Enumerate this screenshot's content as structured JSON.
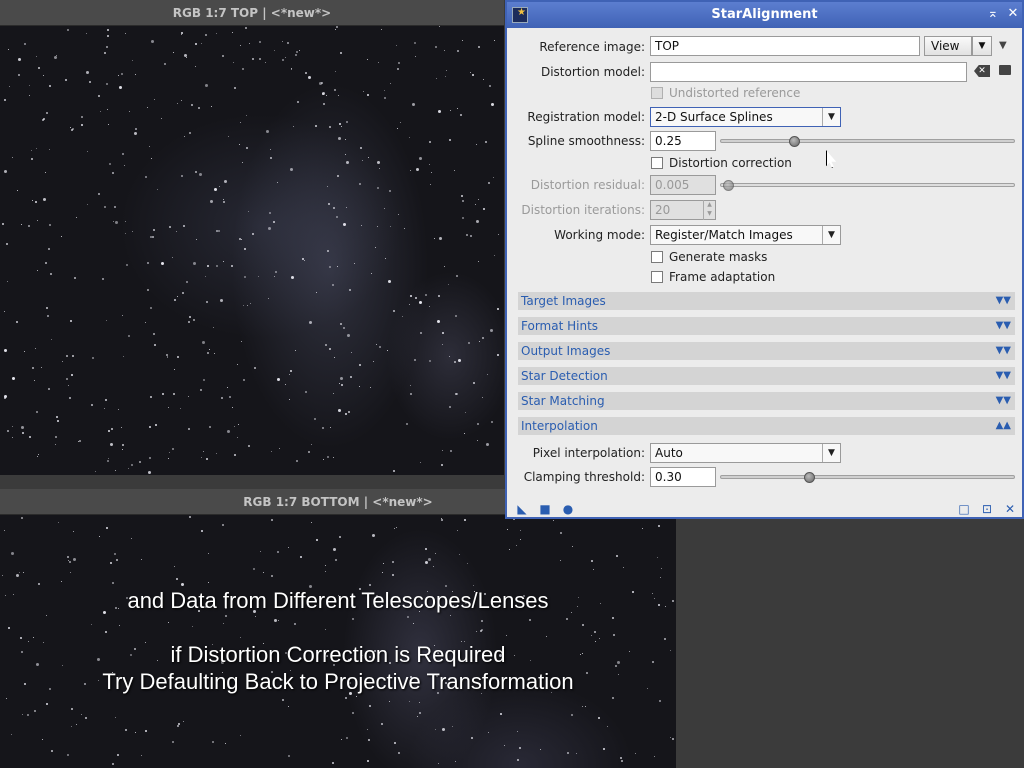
{
  "top_window": {
    "title": "RGB 1:7 TOP | <*new*>"
  },
  "bottom_window": {
    "title": "RGB 1:7 BOTTOM | <*new*>"
  },
  "captions": [
    "and Data from Different Telescopes/Lenses",
    "if Distortion Correction is Required",
    "Try Defaulting Back to Projective Transformation"
  ],
  "dialog": {
    "title": "StarAlignment",
    "title_buttons": {
      "shade": "⌅",
      "close": "✕"
    },
    "reference_image": {
      "label": "Reference image:",
      "value": "TOP",
      "view_label": "View"
    },
    "distortion_model": {
      "label": "Distortion model:",
      "value": ""
    },
    "undistorted_reference": {
      "label": "Undistorted reference",
      "checked": false,
      "enabled": false
    },
    "registration_model": {
      "label": "Registration model:",
      "value": "2-D Surface Splines"
    },
    "spline_smoothness": {
      "label": "Spline smoothness:",
      "value": "0.25",
      "level": 0.25
    },
    "distortion_correction": {
      "label": "Distortion correction",
      "checked": false
    },
    "distortion_residual": {
      "label": "Distortion residual:",
      "value": "0.005",
      "enabled": false
    },
    "distortion_iterations": {
      "label": "Distortion iterations:",
      "value": "20",
      "enabled": false
    },
    "working_mode": {
      "label": "Working mode:",
      "value": "Register/Match Images"
    },
    "generate_masks": {
      "label": "Generate masks",
      "checked": false
    },
    "frame_adaptation": {
      "label": "Frame adaptation",
      "checked": false
    },
    "sections": [
      {
        "label": "Target Images",
        "expanded": false
      },
      {
        "label": "Format Hints",
        "expanded": false
      },
      {
        "label": "Output Images",
        "expanded": false
      },
      {
        "label": "Star Detection",
        "expanded": false
      },
      {
        "label": "Star Matching",
        "expanded": false
      },
      {
        "label": "Interpolation",
        "expanded": true
      }
    ],
    "pixel_interpolation": {
      "label": "Pixel interpolation:",
      "value": "Auto"
    },
    "clamping_threshold": {
      "label": "Clamping threshold:",
      "value": "0.30",
      "level": 0.3
    }
  }
}
